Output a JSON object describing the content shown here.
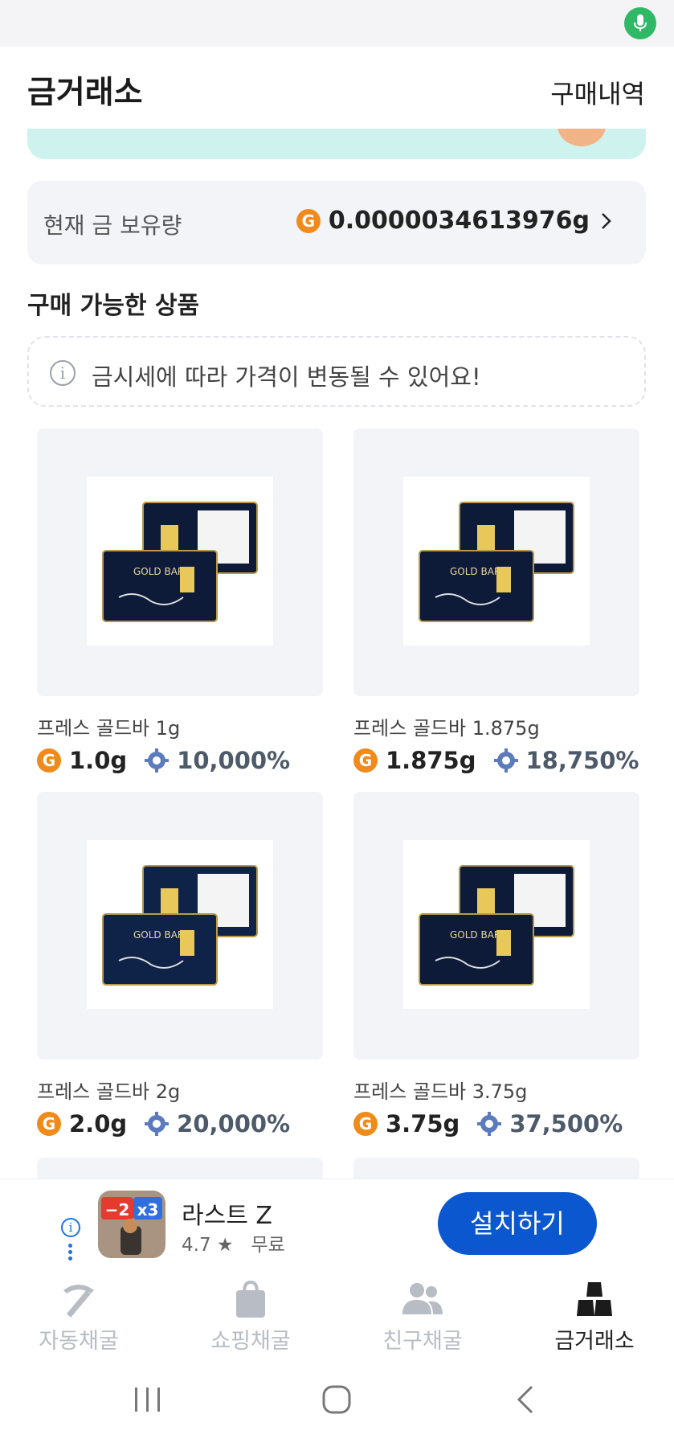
{
  "header": {
    "title": "금거래소",
    "history_label": "구매내역"
  },
  "holdings": {
    "label": "현재 금 보유량",
    "value": "0.0000034613976g",
    "coin_letter": "G"
  },
  "section_title": "구매 가능한 상품",
  "notice": {
    "icon_glyph": "i",
    "text": "금시세에 따라 가격이 변동될 수 있어요!"
  },
  "products": [
    {
      "name": "프레스 골드바 1g",
      "gold": "1.0g",
      "percent": "10,000%",
      "label": "GOLD BAR"
    },
    {
      "name": "프레스 골드바 1.875g",
      "gold": "1.875g",
      "percent": "18,750%",
      "label": "GOLD BAR"
    },
    {
      "name": "프레스 골드바 2g",
      "gold": "2.0g",
      "percent": "20,000%",
      "label": "GOLD BAR"
    },
    {
      "name": "프레스 골드바 3.75g",
      "gold": "3.75g",
      "percent": "37,500%",
      "label": "GOLD BAR"
    }
  ],
  "ad": {
    "app_name": "라스트 Z",
    "rating": "4.7 ★",
    "price": "무료",
    "install_label": "설치하기",
    "icon_text_a": "−2",
    "icon_text_b": "x3"
  },
  "tabs": [
    {
      "label": "자동채굴",
      "icon": "pickaxe-icon"
    },
    {
      "label": "쇼핑채굴",
      "icon": "shopping-bag-icon"
    },
    {
      "label": "친구채굴",
      "icon": "friends-icon"
    },
    {
      "label": "금거래소",
      "icon": "gold-bars-icon",
      "active": true
    }
  ],
  "colors": {
    "accent_gold": "#f08a1a",
    "install_blue": "#0b57d0",
    "mic_green": "#2fb866",
    "banner_mint": "#cef3ee"
  }
}
